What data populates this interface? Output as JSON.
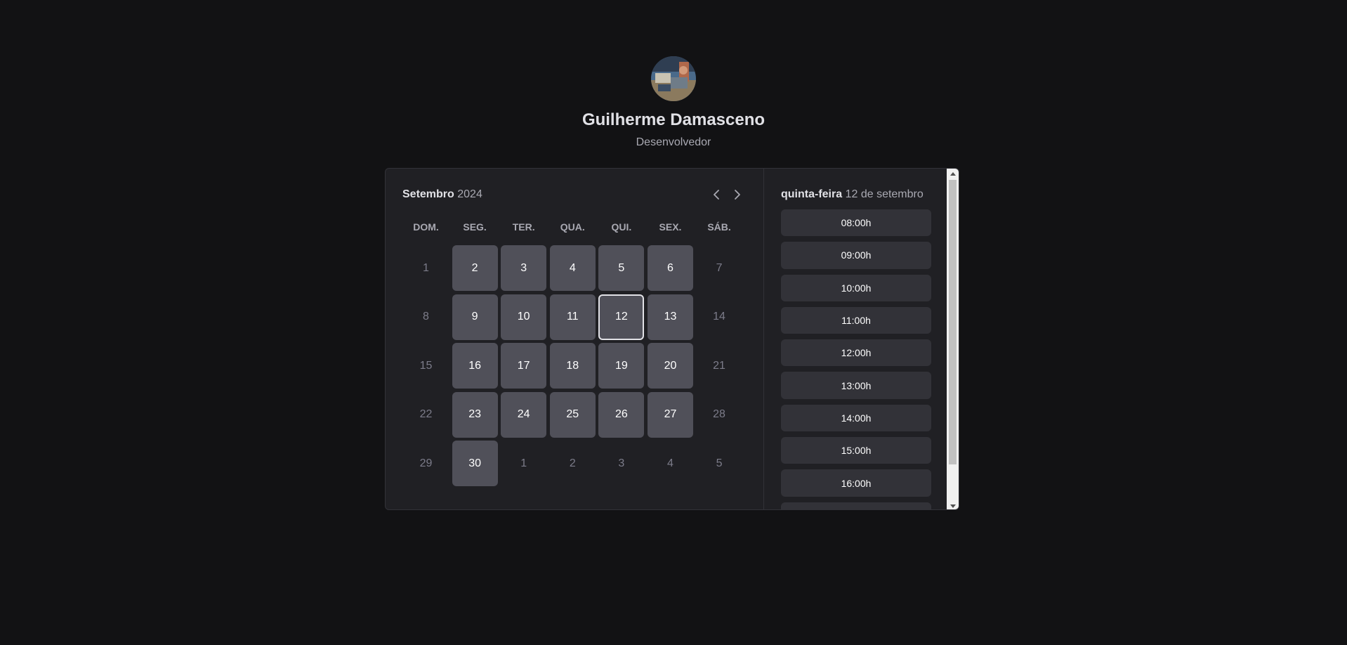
{
  "profile": {
    "name": "Guilherme Damasceno",
    "bio": "Desenvolvedor"
  },
  "calendar": {
    "month": "Setembro",
    "year": "2024",
    "weekdays": [
      "DOM.",
      "SEG.",
      "TER.",
      "QUA.",
      "QUI.",
      "SEX.",
      "SÁB."
    ],
    "days": [
      {
        "label": "1",
        "available": false
      },
      {
        "label": "2",
        "available": true
      },
      {
        "label": "3",
        "available": true
      },
      {
        "label": "4",
        "available": true
      },
      {
        "label": "5",
        "available": true
      },
      {
        "label": "6",
        "available": true
      },
      {
        "label": "7",
        "available": false
      },
      {
        "label": "8",
        "available": false
      },
      {
        "label": "9",
        "available": true
      },
      {
        "label": "10",
        "available": true
      },
      {
        "label": "11",
        "available": true
      },
      {
        "label": "12",
        "available": true,
        "selected": true
      },
      {
        "label": "13",
        "available": true
      },
      {
        "label": "14",
        "available": false
      },
      {
        "label": "15",
        "available": false
      },
      {
        "label": "16",
        "available": true
      },
      {
        "label": "17",
        "available": true
      },
      {
        "label": "18",
        "available": true
      },
      {
        "label": "19",
        "available": true
      },
      {
        "label": "20",
        "available": true
      },
      {
        "label": "21",
        "available": false
      },
      {
        "label": "22",
        "available": false
      },
      {
        "label": "23",
        "available": true
      },
      {
        "label": "24",
        "available": true
      },
      {
        "label": "25",
        "available": true
      },
      {
        "label": "26",
        "available": true
      },
      {
        "label": "27",
        "available": true
      },
      {
        "label": "28",
        "available": false
      },
      {
        "label": "29",
        "available": false
      },
      {
        "label": "30",
        "available": true
      },
      {
        "label": "1",
        "available": false
      },
      {
        "label": "2",
        "available": false
      },
      {
        "label": "3",
        "available": false
      },
      {
        "label": "4",
        "available": false
      },
      {
        "label": "5",
        "available": false
      }
    ]
  },
  "time_picker": {
    "weekday": "quinta-feira",
    "date": "12 de setembro",
    "times": [
      "08:00h",
      "09:00h",
      "10:00h",
      "11:00h",
      "12:00h",
      "13:00h",
      "14:00h",
      "15:00h",
      "16:00h",
      ""
    ]
  },
  "icons": {
    "prev": "chevron-left-icon",
    "next": "chevron-right-icon"
  },
  "colors": {
    "background": "#121214",
    "panel": "#202024",
    "day_available": "#505059",
    "time_button": "#323238",
    "text": "#e1e1e6",
    "muted": "#a9a9b2"
  }
}
